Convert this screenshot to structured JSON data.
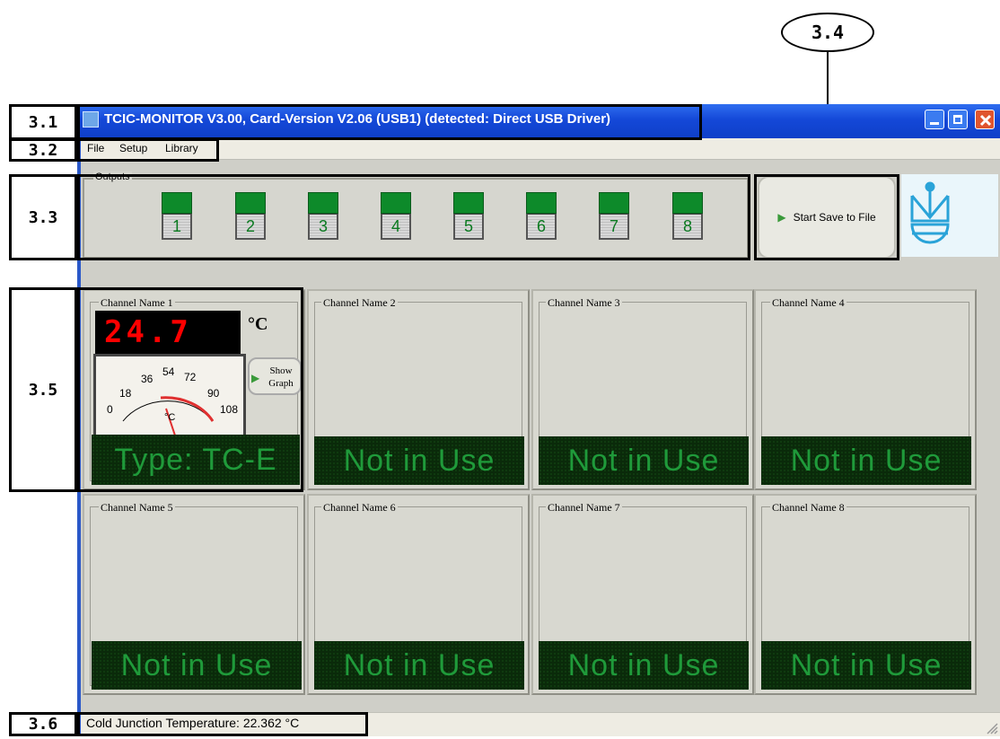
{
  "callout": "3.4",
  "labels": {
    "l31": "3.1",
    "l32": "3.2",
    "l33": "3.3",
    "l35": "3.5",
    "l36": "3.6"
  },
  "window": {
    "title": "TCIC-MONITOR V3.00, Card-Version  V2.06 (USB1) (detected: Direct USB Driver)"
  },
  "menu": {
    "file": "File",
    "setup": "Setup",
    "library": "Library"
  },
  "outputs": {
    "label": "Outputs",
    "buttons": [
      "1",
      "2",
      "3",
      "4",
      "5",
      "6",
      "7",
      "8"
    ]
  },
  "save_button": "Start Save to File",
  "channel1": {
    "name": "Channel Name 1",
    "reading": "24.7",
    "unit": "°C",
    "meter": {
      "ticks": [
        "0",
        "18",
        "36",
        "54",
        "72",
        "90",
        "108"
      ],
      "unit": "°C"
    },
    "show_graph": "Show Graph",
    "display": "Type: TC-E"
  },
  "channels": [
    {
      "name": "Channel Name 2",
      "display": "Not in Use"
    },
    {
      "name": "Channel Name 3",
      "display": "Not in Use"
    },
    {
      "name": "Channel Name 4",
      "display": "Not in Use"
    },
    {
      "name": "Channel Name 5",
      "display": "Not in Use"
    },
    {
      "name": "Channel Name 6",
      "display": "Not in Use"
    },
    {
      "name": "Channel Name 7",
      "display": "Not in Use"
    },
    {
      "name": "Channel Name 8",
      "display": "Not in Use"
    }
  ],
  "status": "Cold Junction Temperature: 22.362 °C",
  "colors": {
    "titlebar": "#1448d8",
    "display_green": "#1f9a3a",
    "led_red": "#ff0000"
  }
}
